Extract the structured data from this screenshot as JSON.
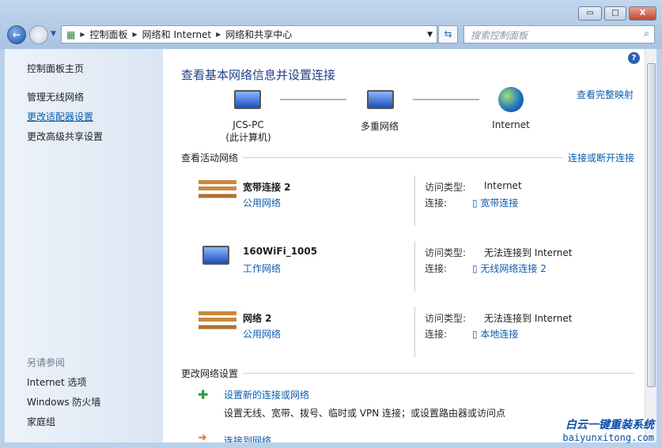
{
  "window": {
    "minimize": "▭",
    "maximize": "□",
    "close": "X"
  },
  "address": {
    "crumbs": [
      "控制面板",
      "网络和 Internet",
      "网络和共享中心"
    ]
  },
  "search": {
    "placeholder": "搜索控制面板"
  },
  "sidebar": {
    "home": "控制面板主页",
    "items": [
      "管理无线网络",
      "更改适配器设置",
      "更改高级共享设置"
    ],
    "see_also": "另请参阅",
    "see_also_items": [
      "Internet 选项",
      "Windows 防火墙",
      "家庭组"
    ]
  },
  "main": {
    "title": "查看基本网络信息并设置连接",
    "full_map": "查看完整映射",
    "map": {
      "pc": "JCS-PC",
      "pc_sub": "(此计算机)",
      "middle": "多重网络",
      "internet": "Internet"
    },
    "active_title": "查看活动网络",
    "connect_link": "连接或断开连接",
    "access_label": "访问类型:",
    "conn_label": "连接:",
    "networks": [
      {
        "name": "宽带连接  2",
        "type": "公用网络",
        "access": "Internet",
        "connection": "宽带连接"
      },
      {
        "name": "160WiFi_1005",
        "type": "工作网络",
        "access": "无法连接到 Internet",
        "connection": "无线网络连接 2"
      },
      {
        "name": "网络  2",
        "type": "公用网络",
        "access": "无法连接到 Internet",
        "connection": "本地连接"
      }
    ],
    "change_title": "更改网络设置",
    "tasks": [
      {
        "title": "设置新的连接或网络",
        "desc": "设置无线、宽带、拨号、临时或 VPN 连接；或设置路由器或访问点"
      },
      {
        "title": "连接到网络"
      }
    ]
  },
  "watermark": {
    "line1": "白云一键重装系统",
    "line2": "baiyunxitong.com"
  }
}
